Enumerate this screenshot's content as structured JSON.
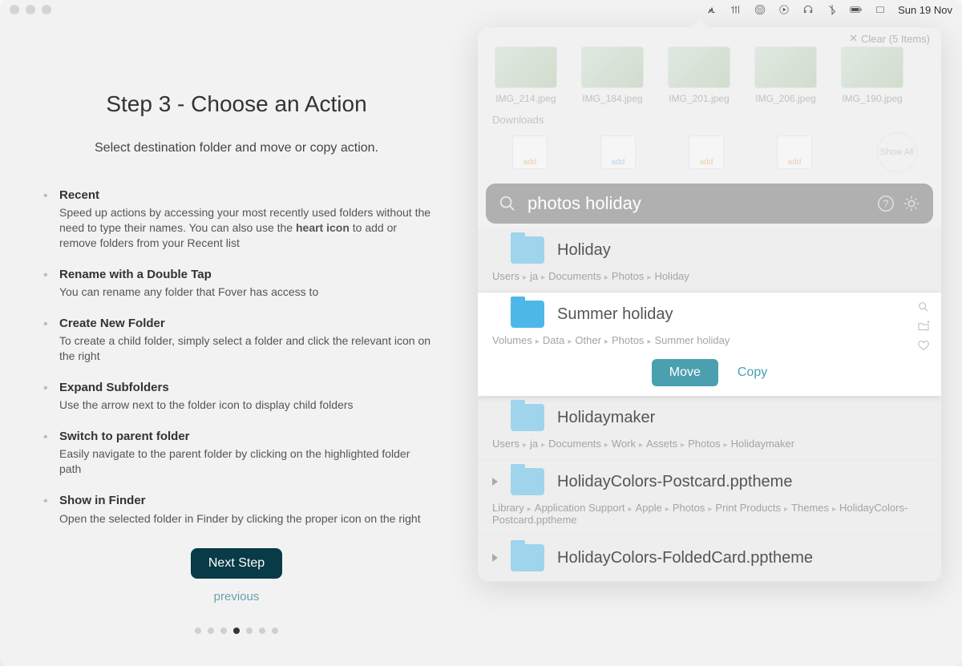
{
  "menubar": {
    "date": "Sun 19 Nov"
  },
  "step": {
    "title": "Step 3 - Choose an Action",
    "subtitle": "Select destination folder and move or copy action.",
    "next_label": "Next Step",
    "prev_label": "previous",
    "pager_active": 3,
    "pager_total": 7
  },
  "tips": [
    {
      "title": "Recent",
      "body_pre": "Speed up actions by accessing your most recently used folders without the need to type their names. You can also use the ",
      "body_strong": "heart icon",
      "body_post": " to add or remove folders from your Recent list"
    },
    {
      "title": "Rename with a Double Tap",
      "body": "You can rename any folder that Fover has access to"
    },
    {
      "title": "Create New Folder",
      "body": "To create a child folder, simply select a folder and click the relevant icon on the right"
    },
    {
      "title": "Expand Subfolders",
      "body": "Use the arrow next to the folder icon to display child folders"
    },
    {
      "title": "Switch to parent folder",
      "body": "Easily navigate to the parent folder by clicking on the highlighted folder path"
    },
    {
      "title": "Show in Finder",
      "body": "Open the selected folder in Finder by clicking the proper icon on the right"
    }
  ],
  "panel": {
    "clear_label": "Clear (5 Items)",
    "thumbs": [
      {
        "label": "IMG_214.jpeg"
      },
      {
        "label": "IMG_184.jpeg"
      },
      {
        "label": "IMG_201.jpeg"
      },
      {
        "label": "IMG_206.jpeg"
      },
      {
        "label": "IMG_190.jpeg"
      }
    ],
    "downloads_label": "Downloads",
    "downloads": [
      {
        "badge": "add"
      },
      {
        "badge": "add"
      },
      {
        "badge": "add"
      },
      {
        "badge": "add"
      }
    ],
    "show_all_label": "Show All",
    "search_text": "photos holiday",
    "move_label": "Move",
    "copy_label": "Copy"
  },
  "results": [
    {
      "title": "Holiday",
      "path": [
        "Users",
        "ja",
        "Documents",
        "Photos",
        "Holiday"
      ],
      "selected": false,
      "expandable": false
    },
    {
      "title": "Summer holiday",
      "path": [
        "Volumes",
        "Data",
        "Other",
        "Photos",
        "Summer holiday"
      ],
      "selected": true,
      "expandable": false
    },
    {
      "title": "Holidaymaker",
      "path": [
        "Users",
        "ja",
        "Documents",
        "Work",
        "Assets",
        "Photos",
        "Holidaymaker"
      ],
      "selected": false,
      "expandable": false
    },
    {
      "title": "HolidayColors-Postcard.pptheme",
      "path": [
        "Library",
        "Application Support",
        "Apple",
        "Photos",
        "Print Products",
        "Themes",
        "HolidayColors-Postcard.pptheme"
      ],
      "selected": false,
      "expandable": true
    },
    {
      "title": "HolidayColors-FoldedCard.pptheme",
      "path": [],
      "selected": false,
      "expandable": true
    }
  ]
}
